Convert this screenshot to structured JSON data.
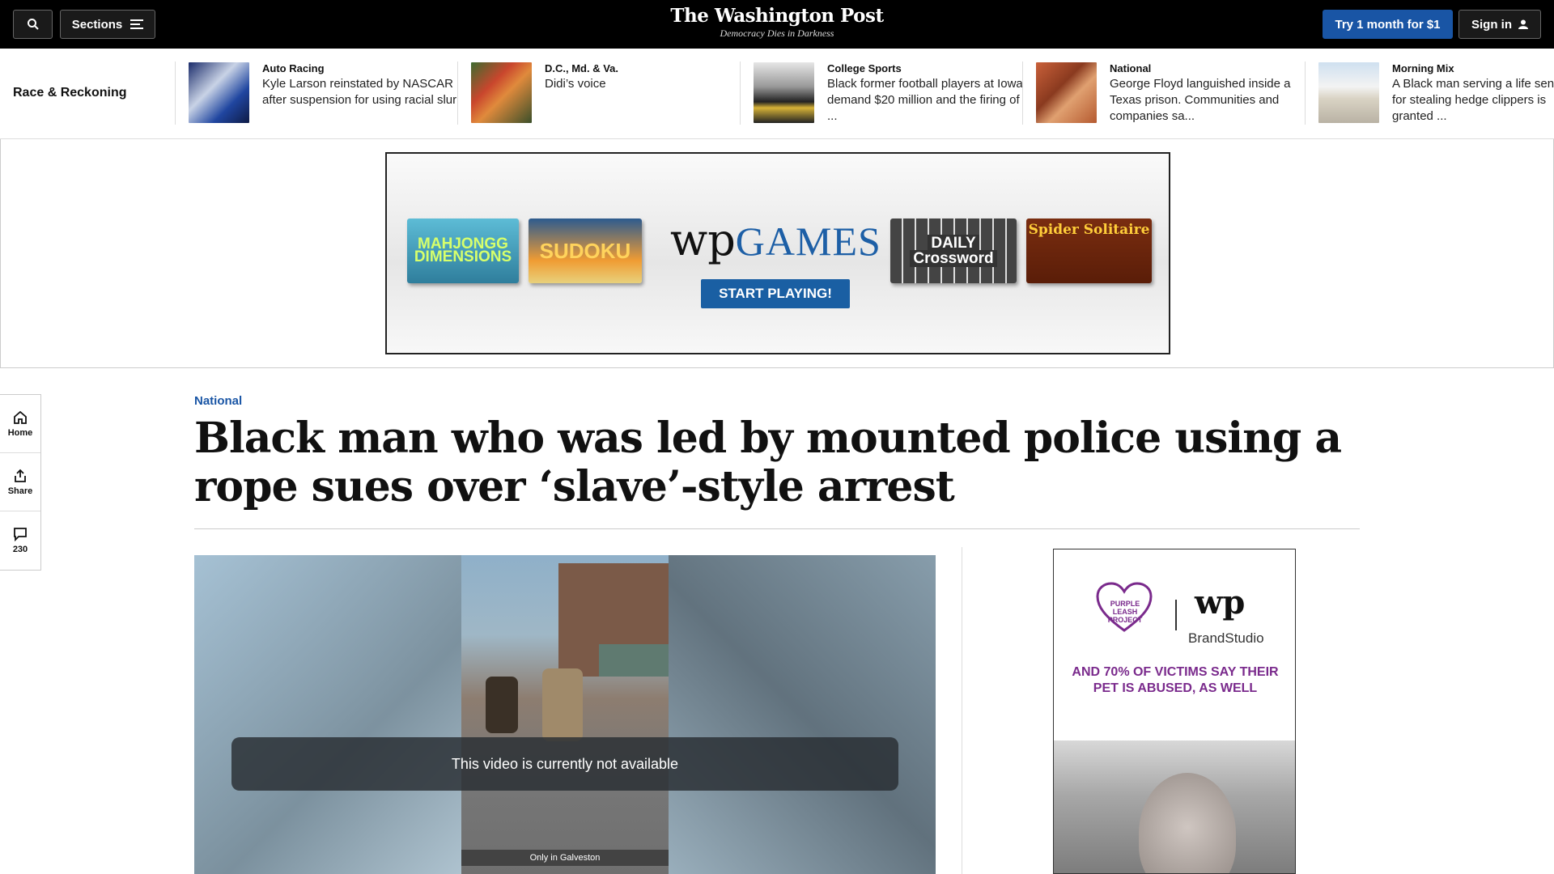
{
  "header": {
    "sections_label": "Sections",
    "logo_name": "The Washington Post",
    "logo_tagline": "Democracy Dies in Darkness",
    "try_label": "Try 1 month for $1",
    "signin_label": "Sign in"
  },
  "strip": {
    "title": "Race & Reckoning",
    "items": [
      {
        "kicker": "Auto Racing",
        "headline": "Kyle Larson reinstated by NASCAR after suspension for using racial slur"
      },
      {
        "kicker": "D.C., Md. & Va.",
        "headline": "Didi’s voice"
      },
      {
        "kicker": "College Sports",
        "headline": "Black former football players at Iowa demand $20 million and the firing of ..."
      },
      {
        "kicker": "National",
        "headline": "George Floyd languished inside a Texas prison. Communities and companies sa..."
      },
      {
        "kicker": "Morning Mix",
        "headline": "A Black man serving a life sentence for stealing hedge clippers is granted ..."
      }
    ]
  },
  "top_ad": {
    "tile1": "MAHJONGG DIMENSIONS",
    "tile2": "SUDOKU",
    "brand_wp": "wp",
    "brand_games": "GAMES",
    "cta": "START PLAYING!",
    "tile3_line1": "DAILY",
    "tile3_line2": "Crossword",
    "tile4": "Spider Solitaire"
  },
  "rail": {
    "home": "Home",
    "share": "Share",
    "comments": "230"
  },
  "article": {
    "section": "National",
    "headline": "Black man who was led by mounted police using a rope sues over ‘slave’-style arrest",
    "video_message": "This video is currently not available",
    "video_caption": "Only in Galveston"
  },
  "side_ad": {
    "project": "PURPLE LEASH PROJECT",
    "wp": "wp",
    "brandstudio": "BrandStudio",
    "stat": "AND 70% OF VICTIMS SAY THEIR PET IS ABUSED, AS WELL"
  },
  "colors": {
    "accent_blue": "#1955a5",
    "ad_purple": "#7a2a8c"
  }
}
